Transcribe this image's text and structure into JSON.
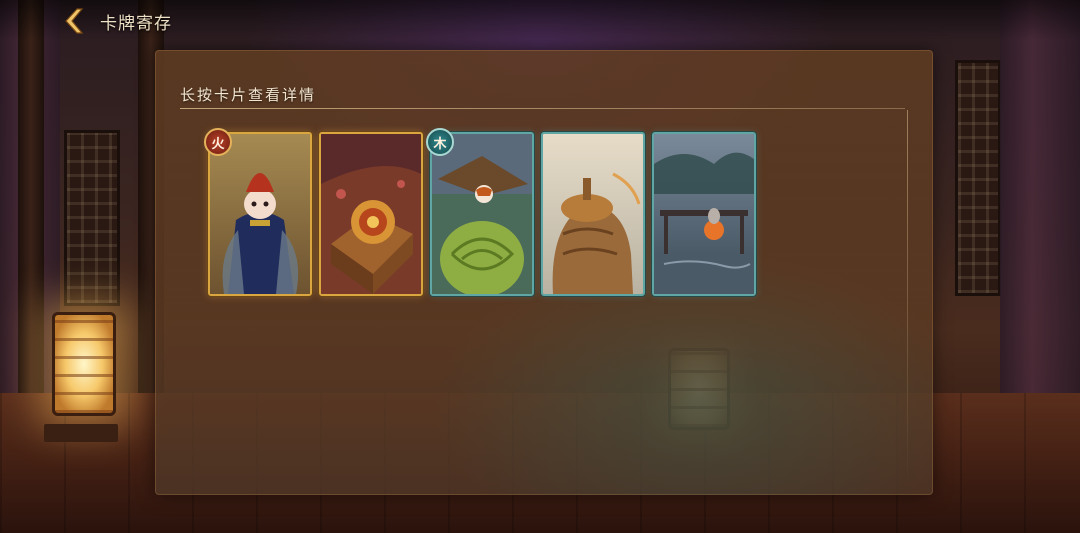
{
  "header": {
    "title": "卡牌寄存",
    "back_icon": "chevron-left-icon"
  },
  "panel": {
    "heading": "长按卡片查看详情"
  },
  "cards": [
    {
      "frame": "gold",
      "badge": "火",
      "badge_icon": "fire-element-icon",
      "art": "character-red-hat-blue-robe"
    },
    {
      "frame": "gold",
      "badge": "",
      "badge_icon": "",
      "art": "bagua-table-scene"
    },
    {
      "frame": "teal",
      "badge": "木",
      "badge_icon": "wood-element-icon",
      "art": "turtle-shell-hat-character"
    },
    {
      "frame": "teal",
      "badge": "",
      "badge_icon": "",
      "art": "bronze-bell-scene"
    },
    {
      "frame": "teal",
      "badge": "",
      "badge_icon": "",
      "art": "stormy-pavilion-scene"
    }
  ],
  "colors": {
    "gold_frame": "#d9a640",
    "teal_frame": "#5fa6a4",
    "title_text": "#efe1c6",
    "panel_bg": "#603c22"
  }
}
